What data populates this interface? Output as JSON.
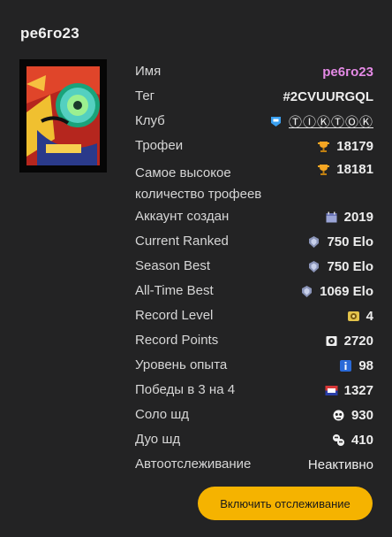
{
  "profile": {
    "title": "ре6го23",
    "avatar_icon": "brawler-portrait-icon"
  },
  "rows": [
    {
      "label": "Имя",
      "value": "ре6го23",
      "icon": ""
    },
    {
      "label": "Тег",
      "value": "#2CVUURGQL",
      "icon": ""
    },
    {
      "label": "Клуб",
      "value": "ⓉⒾⓀⓉⓄⓀ",
      "icon": "club-badge-icon"
    },
    {
      "label": "Трофеи",
      "value": "18179",
      "icon": "trophy-icon"
    },
    {
      "label": "Самое высокое количество трофеев",
      "value": "18181",
      "icon": "trophy-icon"
    },
    {
      "label": "Аккаунт создан",
      "value": "2019",
      "icon": "calendar-icon"
    },
    {
      "label": "Current Ranked",
      "value": "750 Elo",
      "icon": "ranked-icon"
    },
    {
      "label": "Season Best",
      "value": "750 Elo",
      "icon": "ranked-icon"
    },
    {
      "label": "All-Time Best",
      "value": "1069 Elo",
      "icon": "ranked-icon"
    },
    {
      "label": "Record Level",
      "value": "4",
      "icon": "record-level-icon"
    },
    {
      "label": "Record Points",
      "value": "2720",
      "icon": "record-points-icon"
    },
    {
      "label": "Уровень опыта",
      "value": "98",
      "icon": "info-icon"
    },
    {
      "label": "Победы в 3 на 4",
      "value": "1327",
      "icon": "3v3-icon"
    },
    {
      "label": "Соло шд",
      "value": "930",
      "icon": "solo-showdown-icon"
    },
    {
      "label": "Дуо шд",
      "value": "410",
      "icon": "duo-showdown-icon"
    },
    {
      "label": "Автоотслеживание",
      "value": "Неактивно",
      "icon": ""
    }
  ],
  "actions": {
    "enable_tracking_label": "Включить отслеживание"
  },
  "colors": {
    "background": "#232324",
    "name_accent": "#e58ae6",
    "button": "#f5b300",
    "trophy": "#f5a623"
  }
}
